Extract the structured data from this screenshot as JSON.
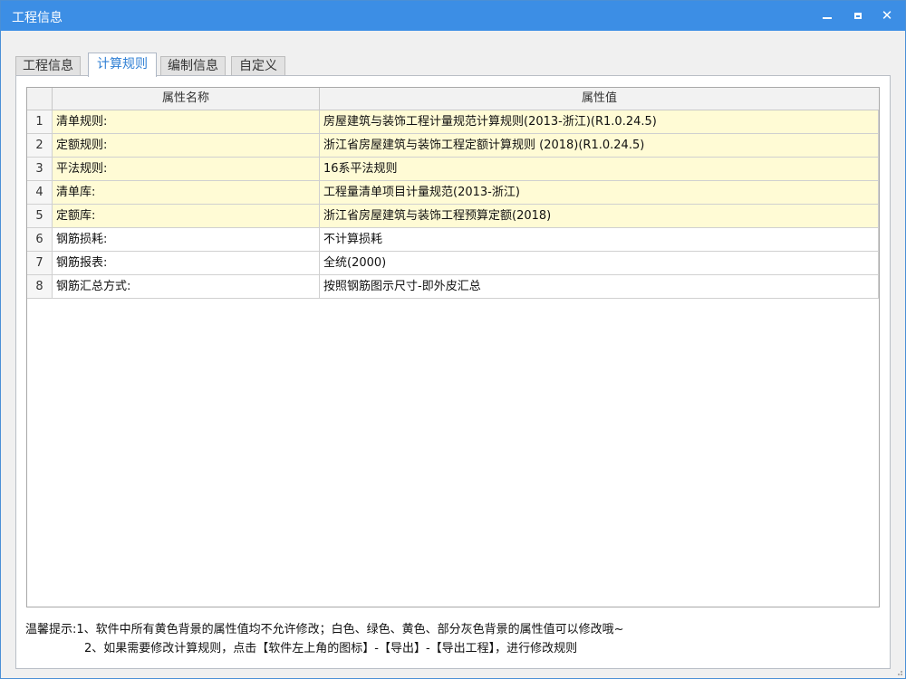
{
  "window": {
    "title": "工程信息",
    "controls": {
      "minimize": "minimize-icon",
      "maximize": "maximize-icon",
      "close": "close-icon"
    }
  },
  "tabs": [
    {
      "label": "工程信息",
      "active": false
    },
    {
      "label": "计算规则",
      "active": true
    },
    {
      "label": "编制信息",
      "active": false
    },
    {
      "label": "自定义",
      "active": false
    }
  ],
  "table": {
    "columns": [
      "属性名称",
      "属性值"
    ],
    "rows": [
      {
        "num": "1",
        "name": "清单规则:",
        "value": "房屋建筑与装饰工程计量规范计算规则(2013-浙江)(R1.0.24.5)",
        "bg": "yellow"
      },
      {
        "num": "2",
        "name": "定额规则:",
        "value": "浙江省房屋建筑与装饰工程定额计算规则 (2018)(R1.0.24.5)",
        "bg": "yellow"
      },
      {
        "num": "3",
        "name": "平法规则:",
        "value": "16系平法规则",
        "bg": "yellow"
      },
      {
        "num": "4",
        "name": "清单库:",
        "value": "工程量清单项目计量规范(2013-浙江)",
        "bg": "yellow"
      },
      {
        "num": "5",
        "name": "定额库:",
        "value": "浙江省房屋建筑与装饰工程预算定额(2018)",
        "bg": "yellow"
      },
      {
        "num": "6",
        "name": "钢筋损耗:",
        "value": "不计算损耗",
        "bg": "white"
      },
      {
        "num": "7",
        "name": "钢筋报表:",
        "value": "全统(2000)",
        "bg": "white"
      },
      {
        "num": "8",
        "name": "钢筋汇总方式:",
        "value": "按照钢筋图示尺寸-即外皮汇总",
        "bg": "white"
      }
    ]
  },
  "tips": {
    "line1": "温馨提示:1、软件中所有黄色背景的属性值均不允许修改；白色、绿色、黄色、部分灰色背景的属性值可以修改哦~",
    "line2": "2、如果需要修改计算规则，点击【软件左上角的图标】-【导出】-【导出工程】，进行修改规则"
  },
  "colors": {
    "titlebar": "#3c8ee5",
    "active_tab_text": "#2f7fd4",
    "locked_cell": "#fffbd5"
  }
}
